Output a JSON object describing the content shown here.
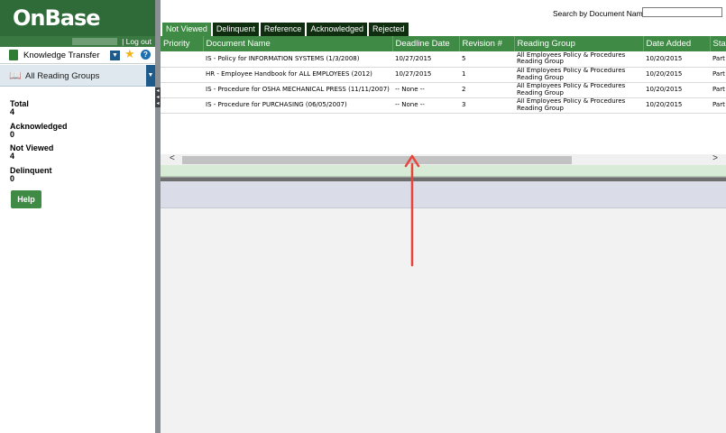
{
  "app": {
    "logo": "OnBase",
    "logout_label": "| Log out"
  },
  "sidebar": {
    "view_name": "Knowledge Transfer",
    "reading_group": "All Reading Groups",
    "stats": [
      {
        "label": "Total",
        "value": "4"
      },
      {
        "label": "Acknowledged",
        "value": "0"
      },
      {
        "label": "Not Viewed",
        "value": "4"
      },
      {
        "label": "Delinquent",
        "value": "0"
      }
    ],
    "help_label": "Help"
  },
  "search": {
    "label": "Search by Document Name:",
    "value": ""
  },
  "tabs": [
    {
      "label": "Not Viewed",
      "active": true
    },
    {
      "label": "Delinquent",
      "active": false
    },
    {
      "label": "Reference",
      "active": false
    },
    {
      "label": "Acknowledged",
      "active": false
    },
    {
      "label": "Rejected",
      "active": false
    }
  ],
  "table": {
    "columns": [
      "Priority",
      "Document Name",
      "Deadline Date",
      "Revision #",
      "Reading Group",
      "Date Added",
      "Sta"
    ],
    "rows": [
      [
        "",
        "IS - Policy for INFORMATION SYSTEMS (1/3/2008)",
        "10/27/2015",
        "5",
        "All Employees Policy & Procedures Reading Group",
        "10/20/2015",
        "Part"
      ],
      [
        "",
        "HR - Employee Handbook for ALL EMPLOYEES (2012)",
        "10/27/2015",
        "1",
        "All Employees Policy & Procedures Reading Group",
        "10/20/2015",
        "Part"
      ],
      [
        "",
        "IS - Procedure for OSHA MECHANICAL PRESS (11/11/2007)",
        "-- None --",
        "2",
        "All Employees Policy & Procedures Reading Group",
        "10/20/2015",
        "Part"
      ],
      [
        "",
        "IS - Procedure for PURCHASING (06/05/2007)",
        "-- None --",
        "3",
        "All Employees Policy & Procedures Reading Group",
        "10/20/2015",
        "Part"
      ]
    ]
  },
  "colors": {
    "brand_green": "#2e6b38",
    "tab_active": "#3f8a45",
    "tab_inactive": "#0e2e0f",
    "annotation_arrow": "#e8443a"
  },
  "icons": {
    "view": "book-green-icon",
    "favorite": "star-icon",
    "help": "question-circle-icon",
    "reading_group": "open-book-icon"
  }
}
